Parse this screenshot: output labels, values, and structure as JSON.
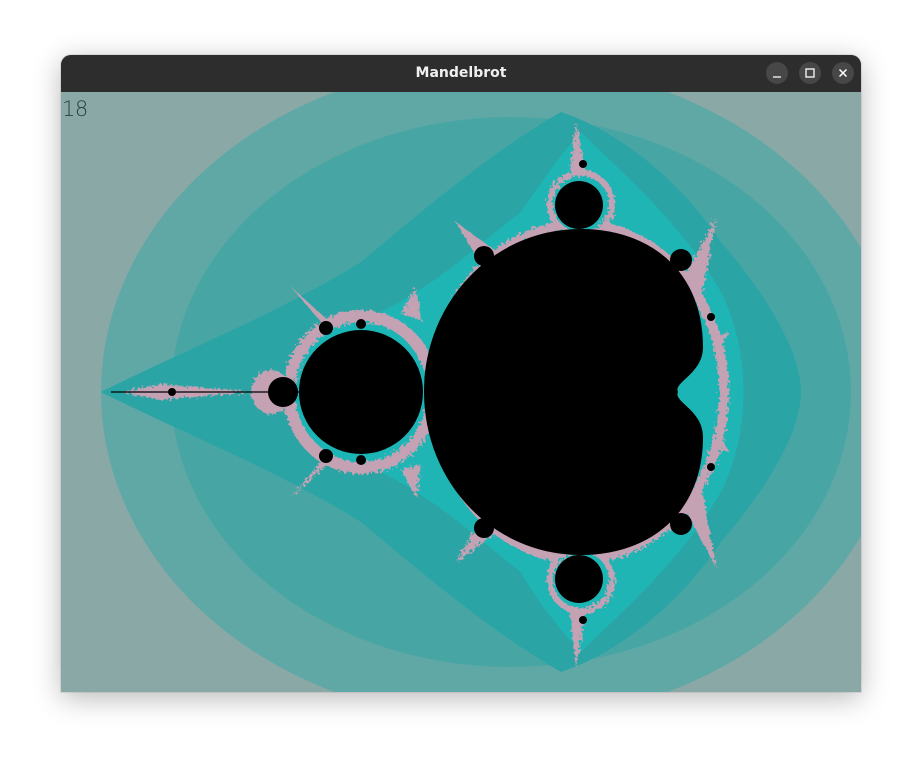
{
  "window": {
    "title": "Mandelbrot",
    "controls": {
      "minimize": "minimize-icon",
      "maximize": "maximize-icon",
      "close": "close-icon"
    }
  },
  "canvas": {
    "iteration_label": "18",
    "colors": {
      "background_outer": "#8aa8a6",
      "teal_band": "#5fa8a6",
      "teal_mid": "#47a6a4",
      "teal_inner": "#2aa4a4",
      "cyan_edge": "#1fb5b5",
      "pink_edge": "#c4a2b4",
      "set_interior": "#000000"
    }
  }
}
